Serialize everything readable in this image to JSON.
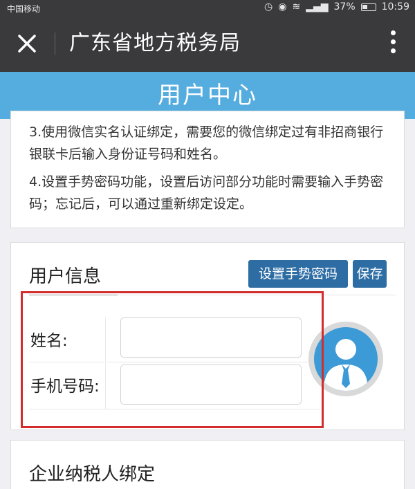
{
  "status_bar": {
    "carrier": "中国移动",
    "battery": "37%",
    "time": "10:59"
  },
  "titlebar": {
    "title": "广东省地方税务局"
  },
  "header": {
    "title": "用户中心"
  },
  "notes": {
    "item3": "3.使用微信实名认证绑定，需要您的微信绑定过有非招商银行银联卡后输入身份证号码和姓名。",
    "item4": "4.设置手势密码功能，设置后访问部分功能时需要输入手势密码；忘记后，可以通过重新绑定设定。"
  },
  "user_info": {
    "section_title": "用户信息",
    "gesture_button": "设置手势密码",
    "save_button": "保存",
    "name_label": "姓名:",
    "name_value": "",
    "phone_label": "手机号码:",
    "phone_value": ""
  },
  "taxpayer": {
    "section_title": "企业纳税人绑定"
  },
  "colors": {
    "titlebar_bg": "#3a3a3c",
    "header_bg": "#55acdf",
    "button_bg": "#2e6da4",
    "highlight_border": "#d32c2c"
  }
}
